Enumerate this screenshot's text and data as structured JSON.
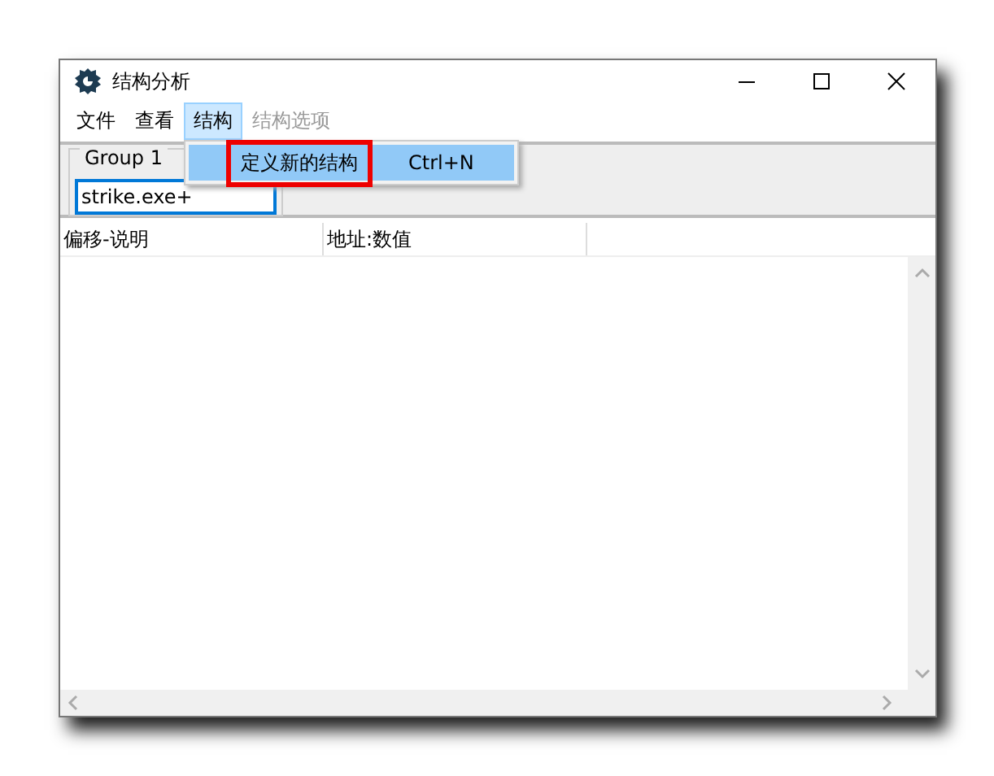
{
  "window": {
    "title": "结构分析"
  },
  "menu_bar": [
    {
      "label": "文件",
      "selected": false,
      "disabled": false
    },
    {
      "label": "查看",
      "selected": false,
      "disabled": false
    },
    {
      "label": "结构",
      "selected": true,
      "disabled": false
    },
    {
      "label": "结构选项",
      "selected": false,
      "disabled": true
    }
  ],
  "dropdown": {
    "items": [
      {
        "label": "定义新的结构",
        "shortcut": "Ctrl+N",
        "selected": true,
        "annotated": true
      }
    ]
  },
  "group": {
    "title": "Group 1",
    "address_field": {
      "value": "strike.exe+"
    }
  },
  "table": {
    "columns": [
      "偏移-说明",
      "地址:数值"
    ]
  }
}
